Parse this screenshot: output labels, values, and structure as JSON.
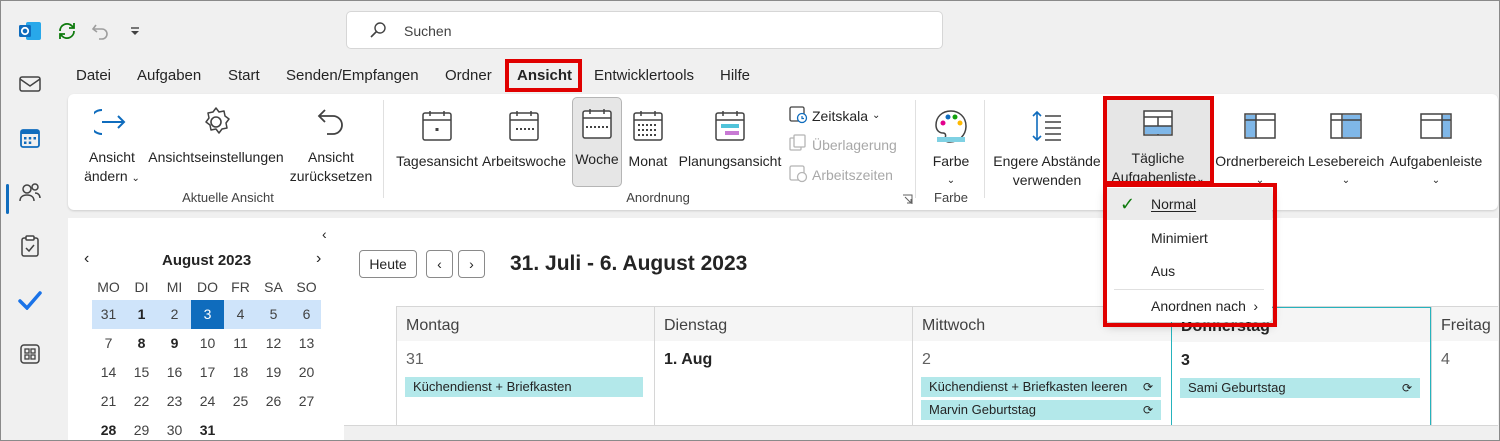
{
  "search": {
    "placeholder": "Suchen"
  },
  "menu": [
    "Datei",
    "Aufgaben",
    "Start",
    "Senden/Empfangen",
    "Ordner",
    "Ansicht",
    "Entwicklertools",
    "Hilfe"
  ],
  "ribbon": {
    "ansicht_aendern": [
      "Ansicht",
      "ändern"
    ],
    "ansichtseinstellungen": "Ansichtseinstellungen",
    "ansicht_zuruecksetzen": [
      "Ansicht",
      "zurücksetzen"
    ],
    "group_aktuelle_ansicht": "Aktuelle Ansicht",
    "tagesansicht": "Tagesansicht",
    "arbeitswoche": "Arbeitswoche",
    "woche": "Woche",
    "monat": "Monat",
    "planungsansicht": "Planungsansicht",
    "zeitskala": "Zeitskala",
    "ueberlagerung": "Überlagerung",
    "arbeitszeiten": "Arbeitszeiten",
    "group_anordnung": "Anordnung",
    "farbe": "Farbe",
    "group_farbe": "Farbe",
    "engere": [
      "Engere Abstände",
      "verwenden"
    ],
    "taegliche": [
      "Tägliche",
      "Aufgabenliste"
    ],
    "ordnerbereich": "Ordnerbereich",
    "lesebereich": "Lesebereich",
    "aufgabenleiste": "Aufgabenleiste"
  },
  "dropdown": {
    "items": [
      "Normal",
      "Minimiert",
      "Aus",
      "Anordnen nach"
    ],
    "checked": "Normal"
  },
  "minical": {
    "title": "August 2023",
    "dow": [
      "MO",
      "DI",
      "MI",
      "DO",
      "FR",
      "SA",
      "SO"
    ],
    "weeks": [
      [
        "31",
        "1",
        "2",
        "3",
        "4",
        "5",
        "6"
      ],
      [
        "7",
        "8",
        "9",
        "10",
        "11",
        "12",
        "13"
      ],
      [
        "14",
        "15",
        "16",
        "17",
        "18",
        "19",
        "20"
      ],
      [
        "21",
        "22",
        "23",
        "24",
        "25",
        "26",
        "27"
      ],
      [
        "28",
        "29",
        "30",
        "31",
        "",
        "",
        ""
      ]
    ],
    "today": "3"
  },
  "calendar": {
    "today_button": "Heute",
    "date_range": "31. Juli - 6. August 2023",
    "days": [
      {
        "name": "Montag",
        "date": "31"
      },
      {
        "name": "Dienstag",
        "date": "1. Aug"
      },
      {
        "name": "Mittwoch",
        "date": "2"
      },
      {
        "name": "Donnerstag",
        "date": "3"
      },
      {
        "name": "Freitag",
        "date": "4"
      }
    ],
    "events": [
      {
        "day": "Montag",
        "title": "Küchendienst + Briefkasten",
        "recurring": false
      },
      {
        "day": "Mittwoch",
        "title": "Küchendienst + Briefkasten leeren",
        "recurring": true
      },
      {
        "day": "Mittwoch",
        "title": "Marvin Geburtstag",
        "recurring": true
      },
      {
        "day": "Donnerstag",
        "title": "Sami Geburtstag",
        "recurring": true
      }
    ]
  },
  "colors": {
    "accent": "#0f6cbd",
    "event_fill": "#b3e8ea",
    "highlight_red": "#e00000"
  }
}
